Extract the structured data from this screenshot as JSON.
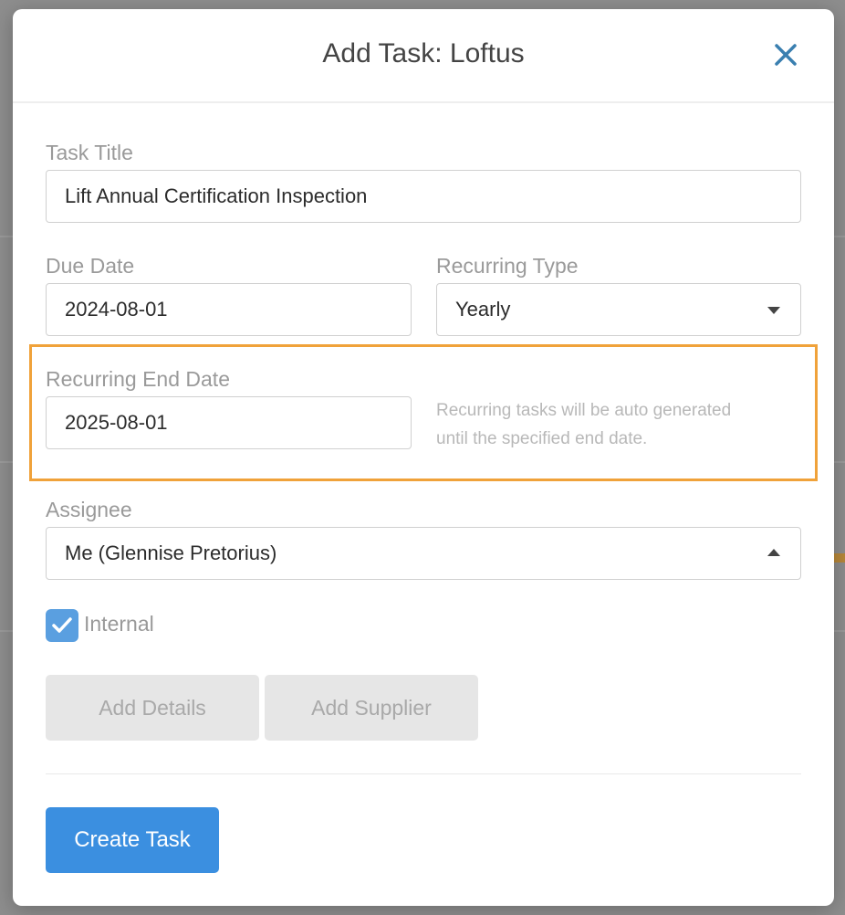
{
  "modal": {
    "title": "Add Task: Loftus",
    "close_icon": "close-icon"
  },
  "form": {
    "task_title": {
      "label": "Task Title",
      "value": "Lift Annual Certification Inspection"
    },
    "due_date": {
      "label": "Due Date",
      "value": "2024-08-01"
    },
    "recurring_type": {
      "label": "Recurring Type",
      "value": "Yearly",
      "icon": "chevron-down-icon"
    },
    "recurring_end_date": {
      "label": "Recurring End Date",
      "value": "2025-08-01",
      "hint_line1": "Recurring tasks will be auto generated",
      "hint_line2": "until the specified end date."
    },
    "assignee": {
      "label": "Assignee",
      "value": "Me (Glennise Pretorius)",
      "icon": "chevron-up-icon"
    },
    "internal": {
      "label": "Internal",
      "checked": true
    }
  },
  "buttons": {
    "add_details": "Add Details",
    "add_supplier": "Add Supplier",
    "create_task": "Create Task"
  },
  "colors": {
    "primary": "#3b8fe0",
    "highlight": "#f0a23a",
    "checkbox": "#5a9fe0",
    "close_icon": "#3a7fb0"
  }
}
